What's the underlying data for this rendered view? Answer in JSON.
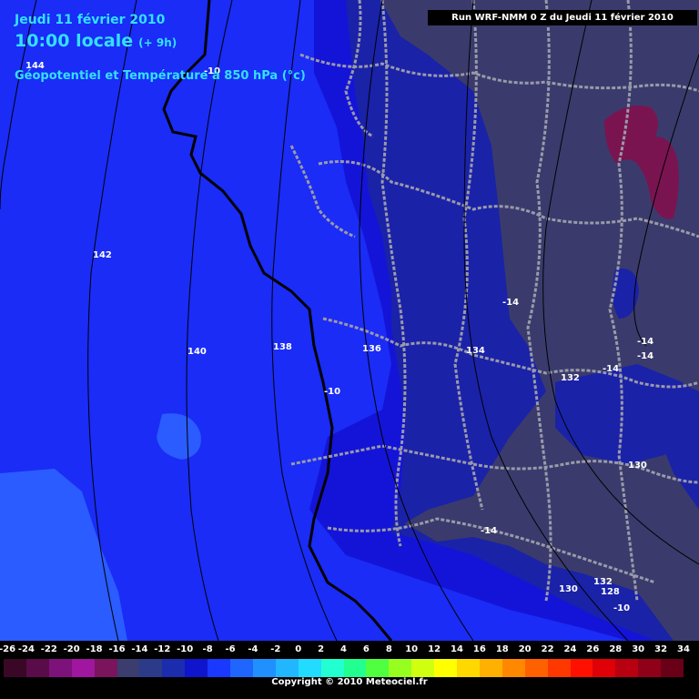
{
  "header": {
    "date": "Jeudi 11 février 2010",
    "time": "10:00 locale",
    "offset": "(+ 9h)",
    "parameter": "Géopotentiel et Température à 850 hPa (°c)",
    "run": "Run WRF-NMM 0 Z du Jeudi 11 février 2010"
  },
  "map_labels": {
    "geopotential": [
      "144",
      "142",
      "140",
      "138",
      "136",
      "134",
      "132",
      "130",
      "132",
      "130",
      "128"
    ],
    "temperature": [
      "-10",
      "-10",
      "-14",
      "-14",
      "-14",
      "-14",
      "-14",
      "-10"
    ]
  },
  "legend": {
    "ticks": [
      "-26",
      "-24",
      "-22",
      "-20",
      "-18",
      "-16",
      "-14",
      "-12",
      "-10",
      "-8",
      "-6",
      "-4",
      "-2",
      "0",
      "2",
      "4",
      "6",
      "8",
      "10",
      "12",
      "14",
      "16",
      "18",
      "20",
      "22",
      "24",
      "26",
      "28",
      "30",
      "32",
      "34"
    ],
    "colors": [
      "#3a0826",
      "#5a0c4a",
      "#7c127a",
      "#a0169e",
      "#7a145c",
      "#3b3d6e",
      "#2c3a8a",
      "#1c2cae",
      "#1014cc",
      "#1a38ff",
      "#1f66ff",
      "#2090ff",
      "#22b6ff",
      "#22dcff",
      "#22ffd0",
      "#22ff90",
      "#50ff40",
      "#96ff20",
      "#d0ff10",
      "#ffff00",
      "#ffd800",
      "#ffb000",
      "#ff8800",
      "#ff6000",
      "#ff3800",
      "#ff1000",
      "#e00008",
      "#b80010",
      "#900018",
      "#6a0018"
    ]
  },
  "footer": {
    "copyright": "Copyright © 2010 Meteociel.fr"
  }
}
